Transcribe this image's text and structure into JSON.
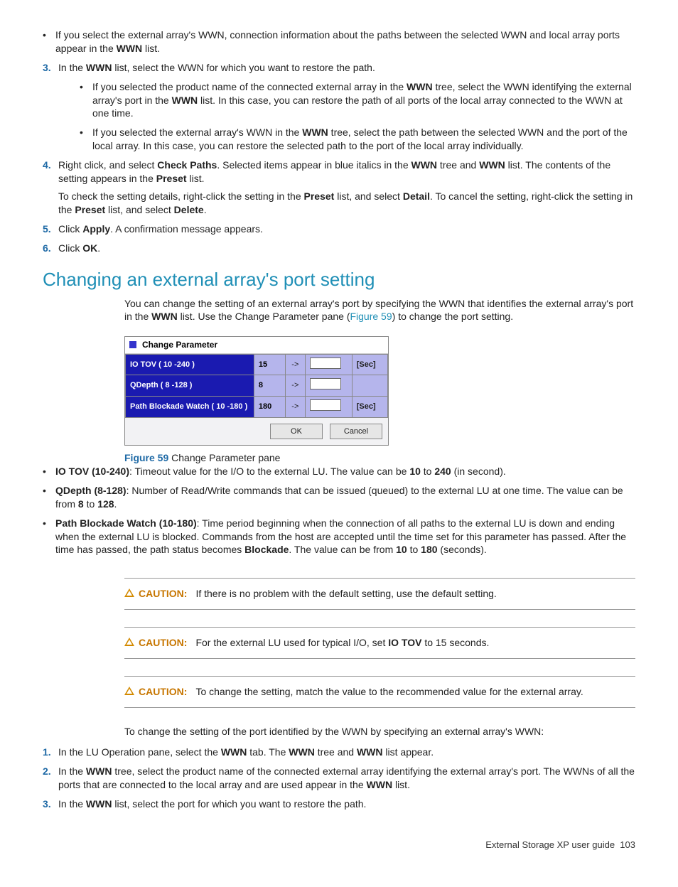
{
  "topLists": {
    "bullet1": "If you select the external array's WWN, connection information about the paths between the selected WWN and local array ports appear in the ",
    "bullet1_wwn": "WWN",
    "bullet1_tail": " list.",
    "step3_pre": "In the ",
    "step3_wwn": "WWN",
    "step3_post": " list, select the WWN for which you want to restore the path.",
    "step3_b1": "If you selected the product name of the connected external array in the ",
    "step3_b1_wwn1": "WWN",
    "step3_b1_mid": " tree, select the WWN identifying the external array's port in the ",
    "step3_b1_wwn2": "WWN",
    "step3_b1_tail": " list. In this case, you can restore the path of all ports of the local array connected to the WWN at one time.",
    "step3_b2": "If you selected the external array's WWN in the ",
    "step3_b2_wwn": "WWN",
    "step3_b2_tail": " tree, select the path between the selected WWN and the port of the local array. In this case, you can restore the selected path to the port of the local array individually.",
    "step4_a": "Right click, and select ",
    "step4_cp": "Check Paths",
    "step4_b": ". Selected items appear in blue italics in the ",
    "step4_wwn": "WWN",
    "step4_c": " tree and ",
    "step4_wwn2": "WWN",
    "step4_d": " list. The contents of the setting appears in the ",
    "step4_preset": "Preset",
    "step4_e": " list.",
    "step4_p2_a": "To check the setting details, right-click the setting in the ",
    "step4_p2_preset": "Preset",
    "step4_p2_b": " list, and select ",
    "step4_p2_detail": "Detail",
    "step4_p2_c": ". To cancel the setting, right-click the setting in the ",
    "step4_p2_preset2": "Preset",
    "step4_p2_d": " list, and select ",
    "step4_p2_delete": "Delete",
    "step4_p2_e": ".",
    "step5_a": "Click ",
    "step5_apply": "Apply",
    "step5_b": ". A confirmation message appears.",
    "step6_a": "Click ",
    "step6_ok": "OK",
    "step6_b": "."
  },
  "section": {
    "title": "Changing an external array's port setting",
    "intro_a": "You can change the setting of an external array's port by specifying the WWN that identifies the external array's port in the ",
    "intro_wwn": "WWN",
    "intro_b": " list. Use the Change Parameter pane (",
    "intro_figlink": "Figure 59",
    "intro_c": ") to change the port setting."
  },
  "pane": {
    "title": "Change Parameter",
    "rows": [
      {
        "label": "IO TOV  ( 10 -240  )",
        "value": "15",
        "unit": "[Sec]"
      },
      {
        "label": "QDepth  ( 8 -128 )",
        "value": "8",
        "unit": ""
      },
      {
        "label": "Path Blockade Watch  ( 10 -180  )",
        "value": "180",
        "unit": "[Sec]"
      }
    ],
    "ok": "OK",
    "cancel": "Cancel"
  },
  "figcaption": {
    "label": "Figure 59",
    "text": " Change Parameter pane"
  },
  "terms": {
    "iotov_b": "IO TOV (10-240)",
    "iotov_a": ": Timeout value for the I/O to the external LU. The value can be ",
    "iotov_v1": "10",
    "iotov_mid": " to ",
    "iotov_v2": "240",
    "iotov_tail": " (in second).",
    "qdepth_b": "QDepth (8-128)",
    "qdepth_a": ": Number of Read/Write commands that can be issued (queued) to the external LU at one time. The value can be from ",
    "qdepth_v1": "8",
    "qdepth_mid": " to ",
    "qdepth_v2": "128",
    "qdepth_tail": ".",
    "pbw_b": "Path Blockade Watch (10-180)",
    "pbw_a": ": Time period beginning when the connection of all paths to the external LU is down and ending when the external LU is blocked. Commands from the host are accepted until the time set for this parameter has passed. After the time has passed, the path status becomes ",
    "pbw_block": "Blockade",
    "pbw_b2": ". The value can be from ",
    "pbw_v1": "10",
    "pbw_mid": " to ",
    "pbw_v2": "180",
    "pbw_tail": " (seconds)."
  },
  "cautions": {
    "label": "CAUTION:",
    "c1": "If there is no problem with the default setting, use the default setting.",
    "c2_a": "For the external LU used for typical I/O, set ",
    "c2_b": "IO TOV",
    "c2_c": " to 15 seconds.",
    "c3": "To change the setting, match the value to the recommended value for the external array."
  },
  "lowerIntro": "To change the setting of the port identified by the WWN by specifying an external array's WWN:",
  "lowerSteps": {
    "s1_a": "In the LU Operation pane, select the ",
    "s1_wwn": "WWN",
    "s1_b": " tab. The ",
    "s1_wwn2": "WWN",
    "s1_c": " tree and ",
    "s1_wwn3": "WWN",
    "s1_d": " list appear.",
    "s2_a": "In the ",
    "s2_wwn": "WWN",
    "s2_b": " tree, select the product name of the connected external array identifying the external array's port. The WWNs of all the ports that are connected to the local array and are used appear in the ",
    "s2_wwn2": "WWN",
    "s2_c": " list.",
    "s3_a": "In the ",
    "s3_wwn": "WWN",
    "s3_b": " list, select the port for which you want to restore the path."
  },
  "footer": {
    "text": "External Storage XP user guide",
    "page": "103"
  }
}
